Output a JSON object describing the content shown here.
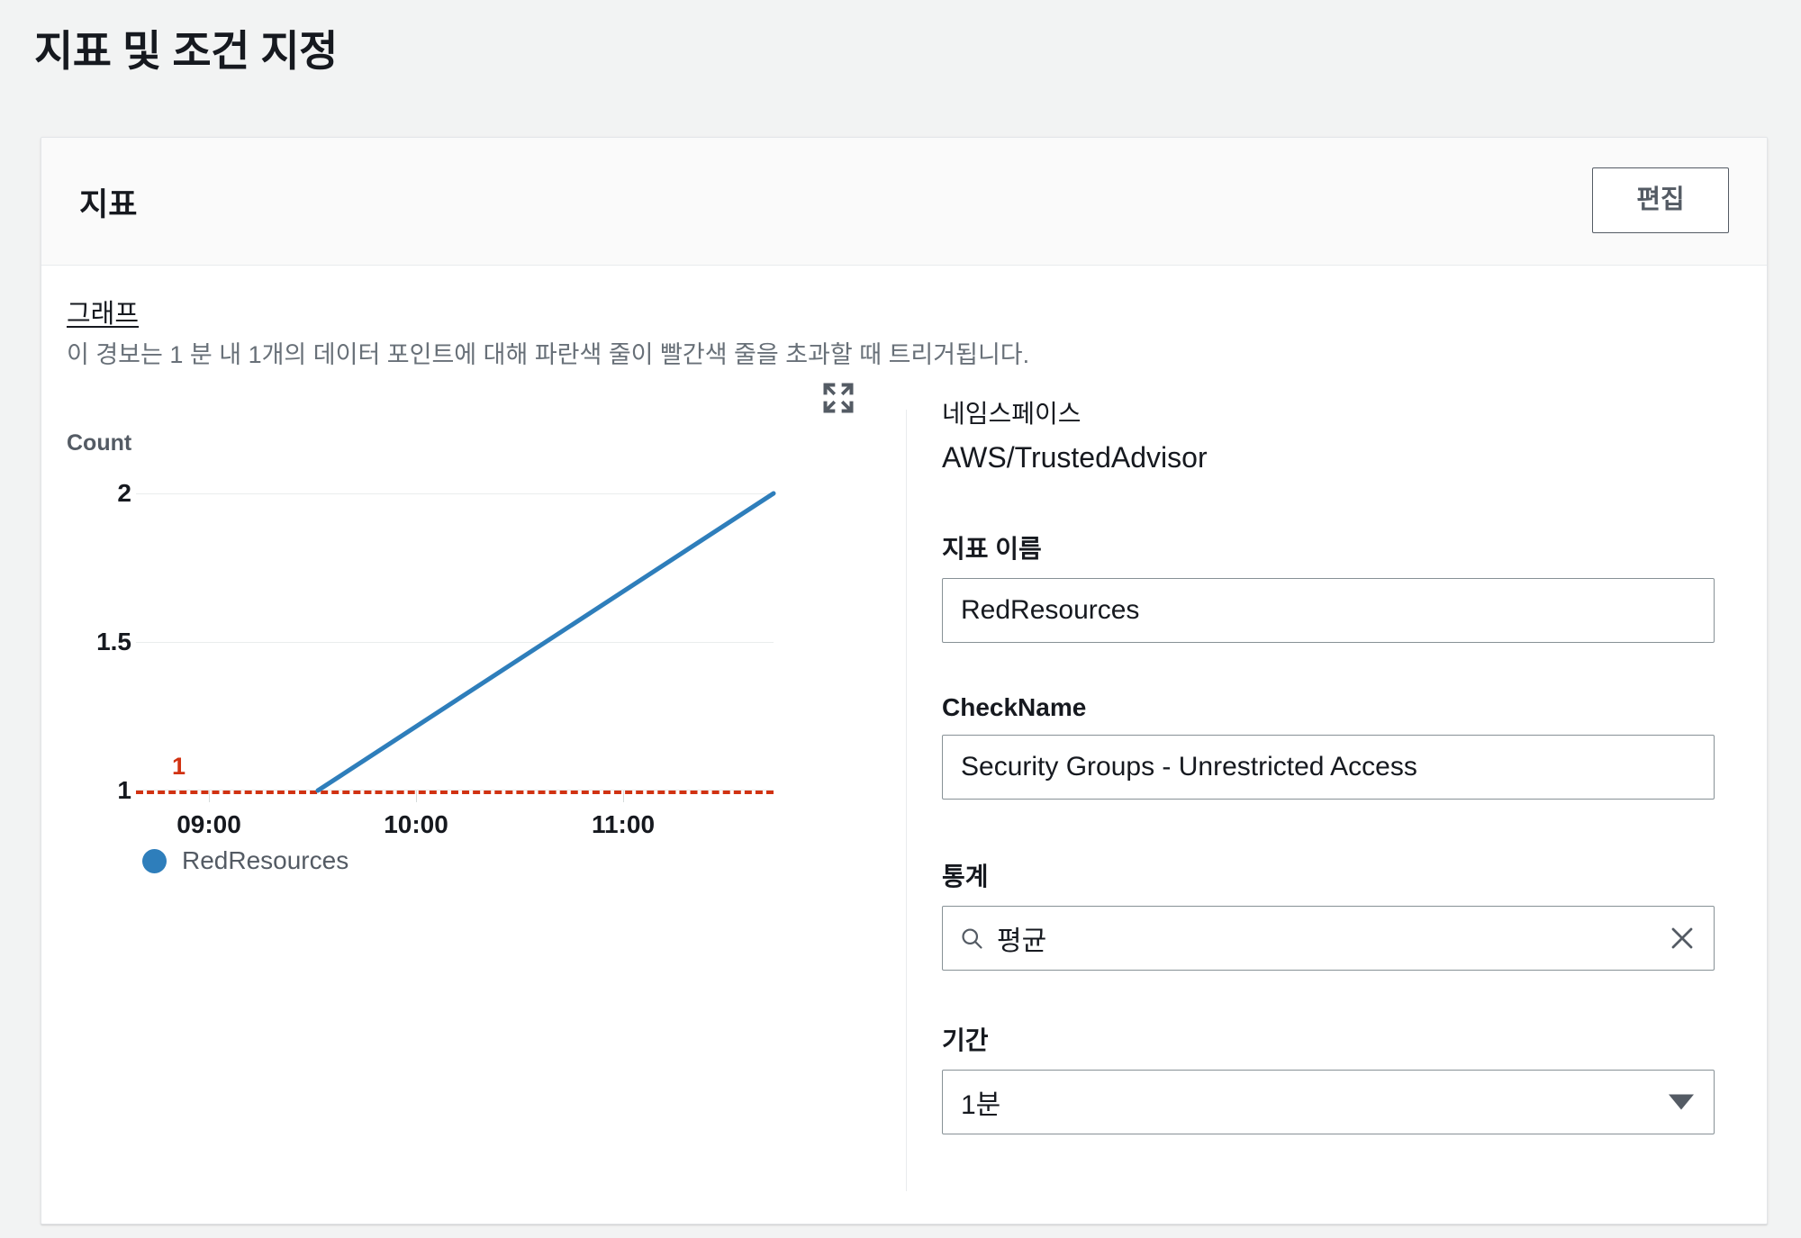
{
  "page": {
    "title": "지표 및 조건 지정"
  },
  "card": {
    "header_title": "지표",
    "edit_label": "편집",
    "graph_heading": "그래프",
    "graph_description": "이 경보는 1 분 내 1개의 데이터 포인트에 대해 파란색 줄이 빨간색 줄을 초과할 때 트리거됩니다.",
    "expand_icon": "expand-icon"
  },
  "form": {
    "namespace_label": "네임스페이스",
    "namespace_value": "AWS/TrustedAdvisor",
    "metric_name_label": "지표 이름",
    "metric_name_value": "RedResources",
    "check_name_label": "CheckName",
    "check_name_value": "Security Groups - Unrestricted Access",
    "statistic_label": "통계",
    "statistic_value": "평균",
    "statistic_search_icon": "search-icon",
    "statistic_clear_icon": "close-icon",
    "period_label": "기간",
    "period_value": "1분",
    "period_caret_icon": "chevron-down-icon"
  },
  "chart_data": {
    "type": "line",
    "title": "",
    "xlabel": "",
    "ylabel": "Count",
    "ylim": [
      1,
      2
    ],
    "yticks": [
      "1",
      "1.5",
      "2"
    ],
    "ytick_values": [
      1,
      1.5,
      2
    ],
    "xticks": [
      "09:00",
      "10:00",
      "11:00"
    ],
    "xtick_positions": [
      0.115,
      0.44,
      0.765
    ],
    "grid": true,
    "legend": [
      "RedResources"
    ],
    "legend_position": "bottom-left",
    "series": [
      {
        "name": "RedResources",
        "color": "#2e7ebb",
        "points": [
          {
            "x": 0.285,
            "y": 1
          },
          {
            "x": 1.0,
            "y": 2
          }
        ]
      }
    ],
    "threshold": {
      "label": "1",
      "value": 1,
      "color": "#d13212",
      "style": "dashed"
    }
  }
}
